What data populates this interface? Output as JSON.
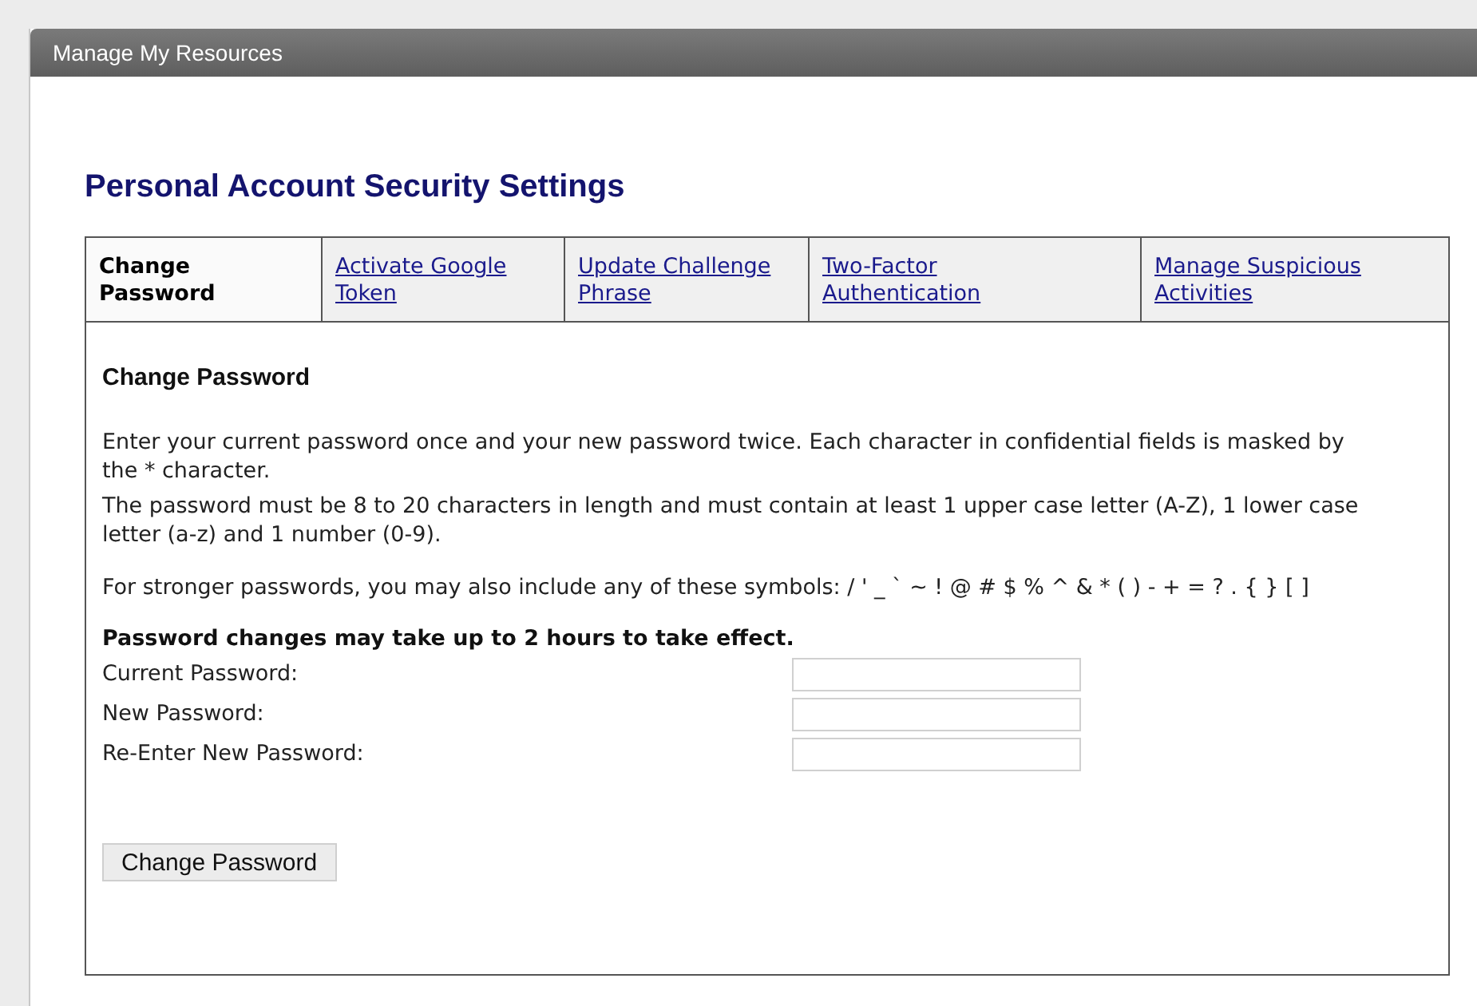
{
  "panel": {
    "title": "Manage My Resources"
  },
  "page_title": "Personal Account Security Settings",
  "tabs": [
    {
      "label": "Change Password",
      "selected": true
    },
    {
      "label": "Activate Google Token",
      "selected": false
    },
    {
      "label": "Update Challenge Phrase",
      "selected": false
    },
    {
      "label": "Two-Factor Authentication",
      "selected": false
    },
    {
      "label": "Manage Suspicious Activities",
      "selected": false
    }
  ],
  "section_title": "Change Password",
  "paragraphs": [
    "Enter your current password once and your new password twice. Each character in confidential fields is masked by the * character.",
    "The password must be 8 to 20 characters in length and must contain at least 1 upper case letter (A-Z), 1 lower case letter (a-z) and 1 number (0-9).",
    "For stronger passwords, you may also include any of these symbols: / ' _ ` ~ ! @ # $ % ^ & * ( ) - + = ? . { } [ ]"
  ],
  "notice": "Password changes may take up to 2 hours to take effect.",
  "fields": [
    {
      "label": "Current Password:"
    },
    {
      "label": "New Password:"
    },
    {
      "label": "Re-Enter New Password:"
    }
  ],
  "submit_button": "Change Password"
}
